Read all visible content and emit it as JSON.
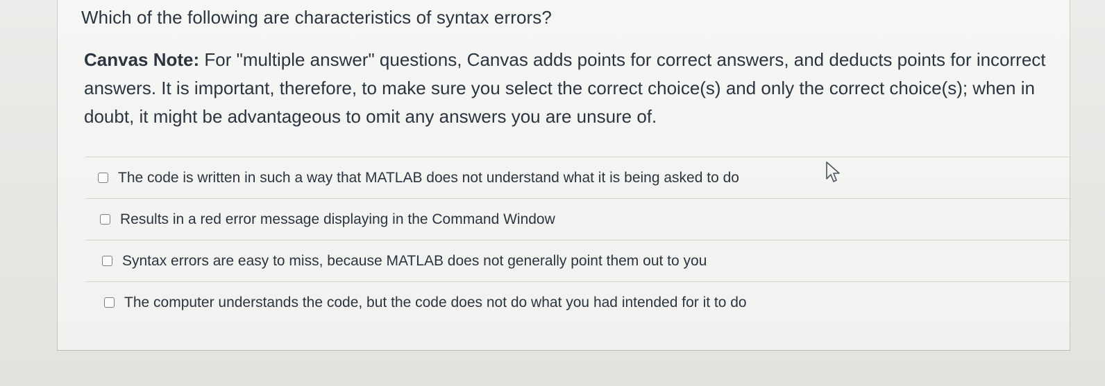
{
  "question": {
    "text": "Which of the following are characteristics of syntax errors?",
    "note_label": "Canvas Note:",
    "note_text": " For \"multiple answer\" questions, Canvas adds points for correct answers, and deducts points for incorrect answers. It is important, therefore, to make sure you select the correct choice(s) and only the correct choice(s); when in doubt, it might be advantageous to omit any answers you are unsure of."
  },
  "answers": [
    {
      "label": "The code is written in such a way that MATLAB does not understand what it is being asked to do",
      "checked": false
    },
    {
      "label": "Results in a red error message displaying in the Command Window",
      "checked": false
    },
    {
      "label": "Syntax errors are easy to miss, because MATLAB does not generally point them out to you",
      "checked": false
    },
    {
      "label": "The computer understands the code, but the code does not do what you had intended for it to do",
      "checked": false
    }
  ],
  "cursor": {
    "icon": "pointer-arrow-icon"
  }
}
